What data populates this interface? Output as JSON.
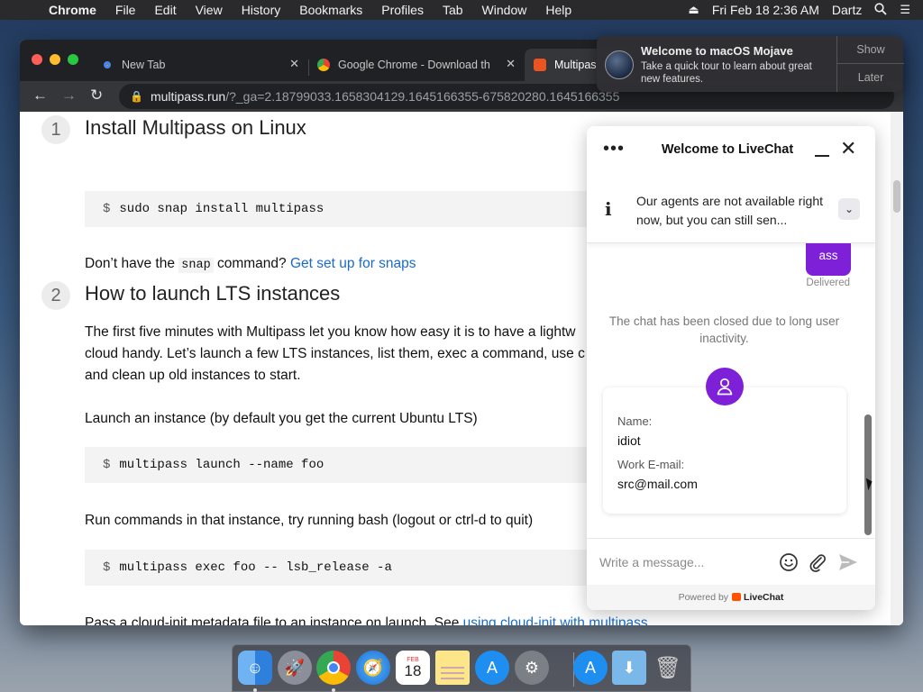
{
  "menubar": {
    "apple_glyph": "",
    "items": [
      "Chrome",
      "File",
      "Edit",
      "View",
      "History",
      "Bookmarks",
      "Profiles",
      "Tab",
      "Window",
      "Help"
    ],
    "datetime": "Fri Feb 18  2:36 AM",
    "user": "Dartz"
  },
  "browser": {
    "tabs": [
      {
        "title": "New Tab"
      },
      {
        "title": "Google Chrome - Download th"
      },
      {
        "title": "Multipas"
      }
    ],
    "url_host": "multipass.run",
    "url_rest": "/?_ga=2.18799033.1658304129.1645166355-675820280.1645166355"
  },
  "page": {
    "step1_num": "1",
    "step1_title": "Install Multipass on Linux",
    "code1": "sudo snap install multipass",
    "prompt": "$",
    "p1_a": "Don’t have the ",
    "p1_code": "snap",
    "p1_b": " command? ",
    "p1_link": "Get set up for snaps",
    "step2_num": "2",
    "step2_title": "How to launch LTS instances",
    "p2_line1": "The first five minutes with Multipass let you know how easy it is to have a lightw",
    "p2_line2": "cloud handy. Let’s launch a few LTS instances, list them, exec a command, use c",
    "p2_line3": "and clean up old instances to start.",
    "p3": "Launch an instance (by default you get the current Ubuntu LTS)",
    "code2": "multipass launch --name foo",
    "p4": "Run commands in that instance, try running bash (logout or ctrl-d to quit)",
    "code3": "multipass exec foo -- lsb_release -a",
    "p5_a": "Pass a cloud-init metadata file to an instance on launch. See ",
    "p5_link": "using cloud-init with multipass"
  },
  "chat": {
    "title": "Welcome to LiveChat",
    "notice": "Our agents are not available right now, but you can still sen...",
    "bubble_text": "ass",
    "delivered": "Delivered",
    "closed_message": "The chat has been closed due to long user inactivity.",
    "name_label": "Name:",
    "name_value": "idiot",
    "email_label": "Work E-mail:",
    "email_value": "src@mail.com",
    "placeholder": "Write a message...",
    "powered_by": "Powered by",
    "brand": "LiveChat",
    "accent_color": "#7e20d8"
  },
  "notification": {
    "title": "Welcome to macOS Mojave",
    "body": "Take a quick tour to learn about great new features.",
    "show": "Show",
    "later": "Later"
  },
  "dock": {
    "calendar_month": "FEB",
    "calendar_day": "18",
    "icons": [
      "finder-icon",
      "launchpad-icon",
      "chrome-icon",
      "safari-icon",
      "calendar-icon",
      "notes-icon",
      "app-store-icon",
      "system-preferences-icon",
      "app-store-icon",
      "downloads-folder-icon",
      "trash-icon"
    ]
  }
}
